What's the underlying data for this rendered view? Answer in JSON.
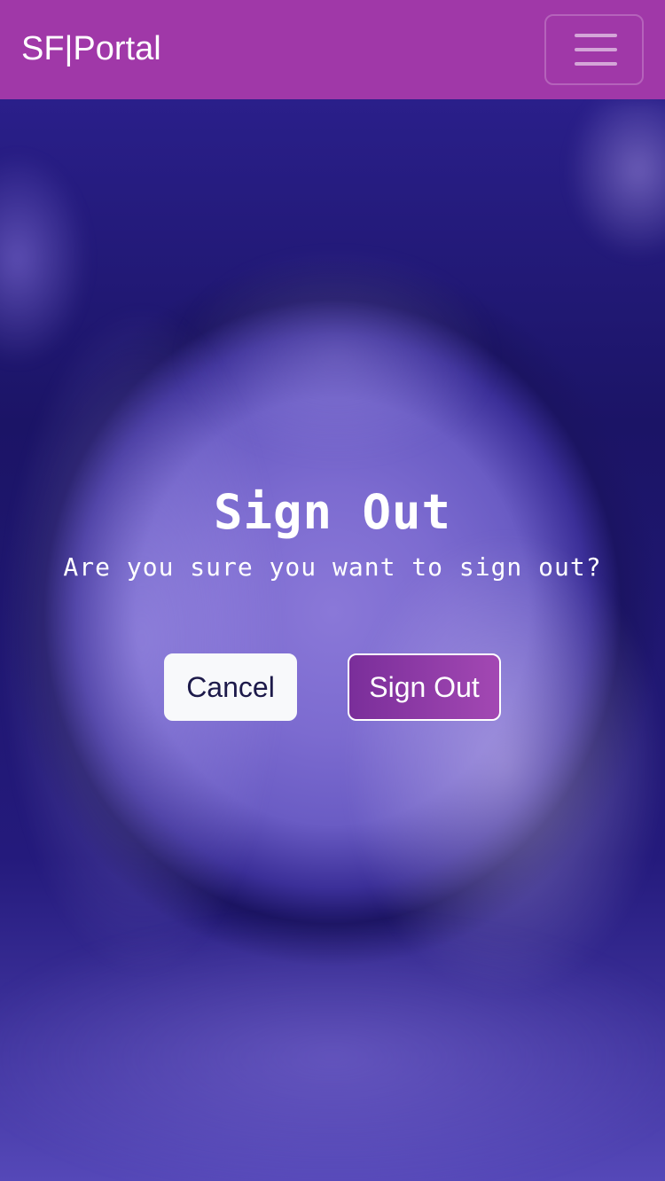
{
  "navbar": {
    "brand": "SF|Portal",
    "menu_icon": "hamburger-menu-icon",
    "background_color": "#a038a8"
  },
  "dialog": {
    "title": "Sign Out",
    "message": "Are you sure you want to sign out?",
    "cancel_label": "Cancel",
    "signout_label": "Sign Out"
  },
  "colors": {
    "accent": "#a038a8",
    "background": "#23186e",
    "cancel_button": "#f8f9fb",
    "signout_button": "#8e3aa8"
  }
}
